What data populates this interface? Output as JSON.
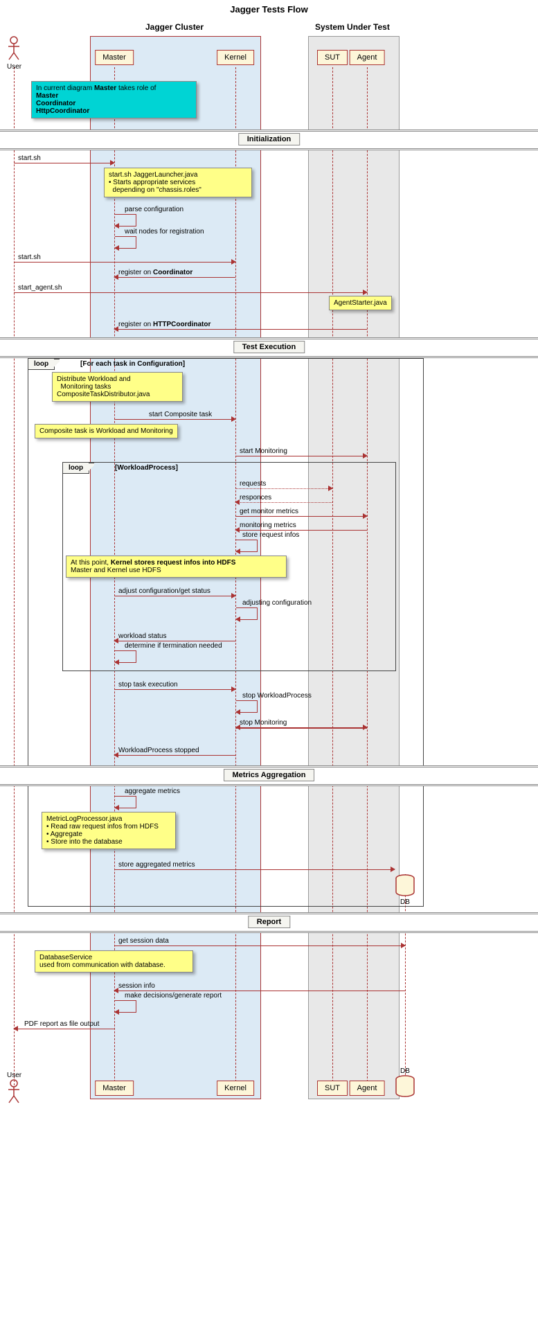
{
  "title": "Jagger Tests Flow",
  "groups": {
    "jagger": "Jagger Cluster",
    "sut": "System Under Test"
  },
  "participants": {
    "user": "User",
    "master": "Master",
    "kernel": "Kernel",
    "sut": "SUT",
    "agent": "Agent",
    "db": "DB"
  },
  "notes": {
    "master_role": "In current diagram <b>Master</b> takes role of<br><b>Master</b><br><b>Coordinator</b><br><b>HttpCoordinator</b>",
    "launcher": "start.sh JaggerLauncher.java<br>• Starts appropriate services<br>&nbsp;&nbsp;depending on \"chassis.roles\"",
    "agentstarter": "AgentStarter.java",
    "distribute": "Distribute Workload and<br>&nbsp;&nbsp;Monitoring tasks<br>CompositeTaskDistributor.java",
    "composite": "Composite task is Workload and Monitoring",
    "hdfs": "At this point, <b>Kernel stores request infos into HDFS</b><br>Master and Kernel use HDFS",
    "metriclog": "MetricLogProcessor.java<br>• Read raw request infos from HDFS<br>• Aggregate<br>• Store into the database",
    "dbservice": "DatabaseService<br>used from communication with database."
  },
  "dividers": {
    "init": "Initialization",
    "exec": "Test Execution",
    "agg": "Metrics Aggregation",
    "report": "Report"
  },
  "frames": {
    "outer": {
      "tag": "loop",
      "title": "[For each task in Configuration]"
    },
    "inner": {
      "tag": "loop",
      "title": "[WorkloadProcess]"
    }
  },
  "messages": {
    "start1": "start.sh",
    "parse": "parse configuration",
    "wait": "wait nodes for registration",
    "start2": "start.sh",
    "regcoord": "register on <b>Coordinator</b>",
    "startagent": "start_agent.sh",
    "reghttp": "register on <b>HTTPCoordinator</b>",
    "startcomp": "start Composite task",
    "startmon": "start Monitoring",
    "requests": "requests",
    "responces": "responces",
    "getmon": "get monitor metrics",
    "monmetrics": "monitoring metrics",
    "storereq": "store request infos",
    "adjust": "adjust configuration/get status",
    "adjusting": "adjusting configuration",
    "wlstatus": "workload status",
    "determine": "determine if termination needed",
    "stoptask": "stop task execution",
    "stopwl": "stop WorkloadProcess",
    "stopmon": "stop Monitoring",
    "wlstopped": "WorkloadProcess stopped",
    "aggmetrics": "aggregate metrics",
    "storeagg": "store aggregated metrics",
    "getsession": "get session data",
    "sessioninfo": "session info",
    "makedec": "make decisions/generate report",
    "pdfout": "PDF report as file output"
  }
}
